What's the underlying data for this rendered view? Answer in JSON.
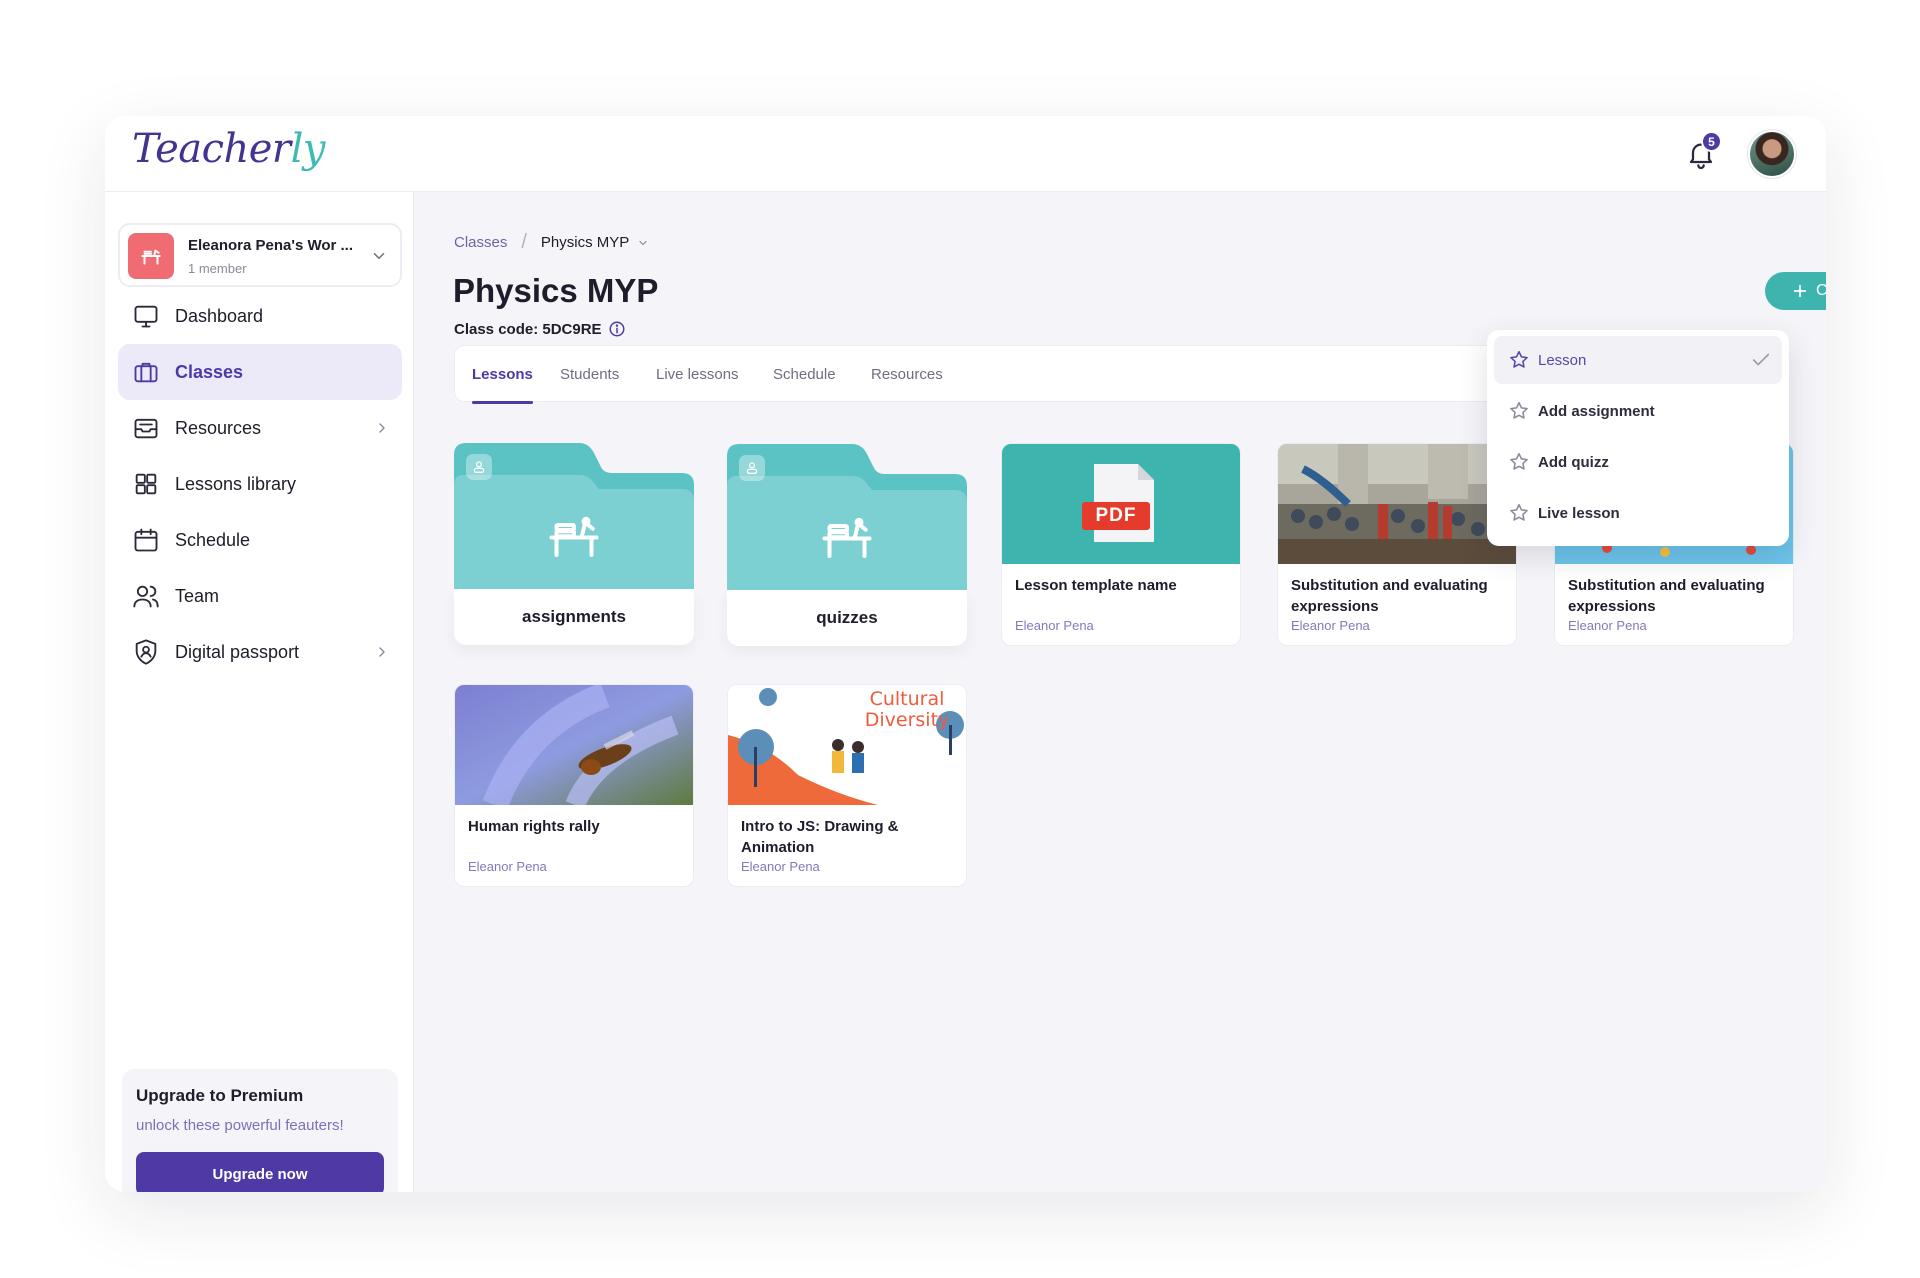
{
  "app": {
    "logo_main": "Teacher",
    "logo_tail": "ly",
    "notification_count": "5"
  },
  "workspace": {
    "name": "Eleanora Pena's Wor ...",
    "members": "1 member"
  },
  "sidebar": {
    "items": [
      {
        "label": "Dashboard"
      },
      {
        "label": "Classes"
      },
      {
        "label": "Resources"
      },
      {
        "label": "Lessons library"
      },
      {
        "label": "Schedule"
      },
      {
        "label": "Team"
      },
      {
        "label": "Digital passport"
      }
    ],
    "premium": {
      "title": "Upgrade to Premium",
      "subtitle": "unlock these powerful feauters!",
      "button": "Upgrade now"
    }
  },
  "breadcrumb": {
    "parent": "Classes",
    "separator": "/",
    "current": "Physics MYP"
  },
  "page": {
    "title": "Physics MYP",
    "class_code": "Class code: 5DC9RE",
    "create_label": "Create"
  },
  "tabs": [
    {
      "label": "Lessons"
    },
    {
      "label": "Students"
    },
    {
      "label": "Live lessons"
    },
    {
      "label": "Schedule"
    },
    {
      "label": "Resources"
    }
  ],
  "folders": [
    {
      "label": "assignments"
    },
    {
      "label": "quizzes"
    }
  ],
  "cards": [
    {
      "title": "Lesson template name",
      "author": "Eleanor Pena",
      "badge": "PDF"
    },
    {
      "title": "Substitution and evaluating expressions",
      "author": "Eleanor Pena"
    },
    {
      "title": "Substitution and evaluating expressions",
      "author": "Eleanor Pena"
    },
    {
      "title": "Human rights rally",
      "author": "Eleanor Pena"
    },
    {
      "title": "Intro to JS: Drawing & Animation",
      "author": "Eleanor Pena",
      "thumb_line1": "Cultural",
      "thumb_line2": "Diversity"
    }
  ],
  "create_menu": {
    "items": [
      {
        "label": "Lesson"
      },
      {
        "label": "Add assignment"
      },
      {
        "label": "Add quizz"
      },
      {
        "label": "Live lesson"
      }
    ]
  },
  "colors": {
    "brand_purple": "#4f3aa5",
    "accent_teal": "#3db5ae",
    "folder_teal": "#7dd0d2",
    "workspace_red": "#f06c72"
  }
}
